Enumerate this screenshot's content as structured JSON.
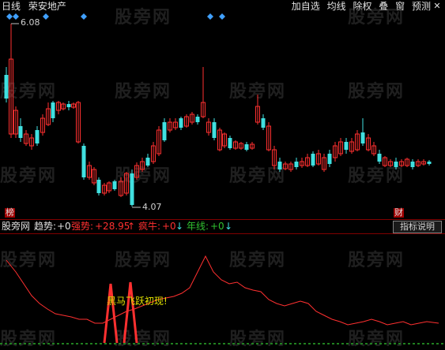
{
  "toolbar": {
    "period": "日线",
    "stock_name": "荣安地产",
    "buttons": [
      "加自选",
      "均线",
      "除权",
      "叠",
      "窗",
      "预测"
    ],
    "close": "✕"
  },
  "watermark": "股旁网",
  "price_labels": {
    "high": "6.08",
    "low": "4.07"
  },
  "markers": {
    "bang": "榜",
    "cai": "财"
  },
  "indicator_bar": {
    "name": "股旁网",
    "items": [
      {
        "label": "趋势:",
        "value": "+0",
        "color": "#e0e0e0"
      },
      {
        "label": "强势:",
        "value": "+28.95",
        "arrow": "↑",
        "color": "#ff3030"
      },
      {
        "label": "疯牛:",
        "value": "+0",
        "arrow": "↓",
        "color": "#ff3030"
      },
      {
        "label": "年线:",
        "value": "+0",
        "arrow": "↓",
        "color": "#30c030"
      }
    ],
    "help_button": "指标说明"
  },
  "signal_text": "黑马飞跃初现!",
  "colors": {
    "up": "#ff3030",
    "down": "#40e0e0",
    "diamond": "#40a0ff"
  }
}
